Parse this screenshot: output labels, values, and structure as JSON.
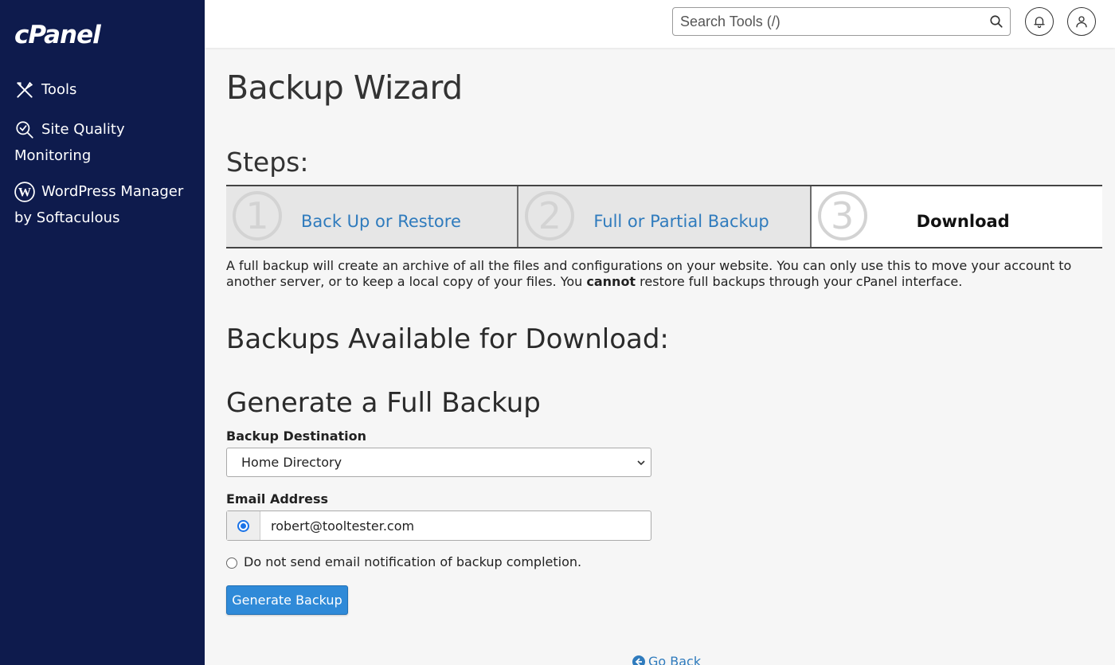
{
  "sidebar": {
    "logo": "cPanel",
    "items": [
      {
        "label": "Tools",
        "icon": "tools-icon"
      },
      {
        "label": "Site Quality Monitoring",
        "icon": "magnifier-check-icon"
      },
      {
        "label": "WordPress Manager by Softaculous",
        "icon": "wordpress-icon"
      }
    ]
  },
  "header": {
    "search_placeholder": "Search Tools (/)",
    "icons": [
      "search-icon",
      "bell-icon",
      "user-icon"
    ]
  },
  "main": {
    "title": "Backup Wizard",
    "steps_heading": "Steps:",
    "steps": [
      {
        "number": "1",
        "label": "Back Up or Restore",
        "active": false
      },
      {
        "number": "2",
        "label": "Full or Partial Backup",
        "active": false
      },
      {
        "number": "3",
        "label": "Download",
        "active": true
      }
    ],
    "description_pre": "A full backup will create an archive of all the files and configurations on your website. You can only use this to move your account to another server, or to keep a local copy of your files. You ",
    "description_bold": "cannot",
    "description_post": " restore full backups through your cPanel interface.",
    "available_heading": "Backups Available for Download:",
    "generate_heading": "Generate a Full Backup",
    "destination_label": "Backup Destination",
    "destination_value": "Home Directory",
    "email_label": "Email Address",
    "email_value": "robert@tooltester.com",
    "no_email_label": "Do not send email notification of backup completion.",
    "generate_button": "Generate Backup",
    "go_back": "Go Back"
  },
  "colors": {
    "sidebar_bg": "#0e1b4d",
    "link": "#2f7bbd",
    "button": "#2f8ad8"
  }
}
